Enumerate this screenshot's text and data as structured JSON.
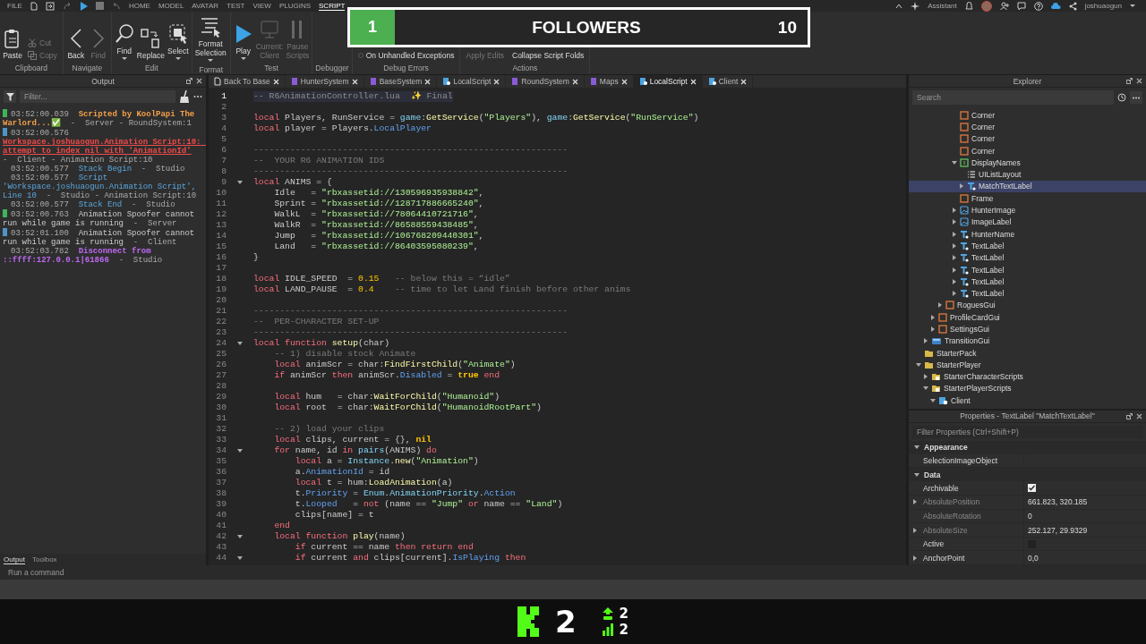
{
  "menu": {
    "file": "FILE",
    "tabs": [
      {
        "label": "HOME",
        "selected": false
      },
      {
        "label": "MODEL",
        "selected": false
      },
      {
        "label": "AVATAR",
        "selected": false
      },
      {
        "label": "TEST",
        "selected": false
      },
      {
        "label": "VIEW",
        "selected": false
      },
      {
        "label": "PLUGINS",
        "selected": false
      },
      {
        "label": "SCRIPT",
        "selected": true
      }
    ],
    "assistant": "Assistant",
    "user": "joshuaogun"
  },
  "ribbon": {
    "groups": [
      {
        "label": "Clipboard",
        "columns": [
          [
            {
              "kind": "large",
              "label": "Paste",
              "disabled": false,
              "caret": false
            }
          ],
          [
            {
              "kind": "small",
              "label": "Cut",
              "disabled": true
            },
            {
              "kind": "small",
              "label": "Copy",
              "disabled": true
            }
          ]
        ]
      },
      {
        "label": "Navigate",
        "columns": [
          [
            {
              "kind": "large",
              "label": "Back",
              "disabled": false,
              "caret": false
            }
          ],
          [
            {
              "kind": "large",
              "label": "Find",
              "disabled": true,
              "caret": false
            }
          ]
        ]
      },
      {
        "label": "Edit",
        "columns": [
          [
            {
              "kind": "large",
              "label": "Find",
              "disabled": false,
              "caret": true
            }
          ],
          [
            {
              "kind": "large",
              "label": "Replace",
              "disabled": false,
              "caret": false
            }
          ],
          [
            {
              "kind": "large",
              "label": "Select",
              "disabled": false,
              "caret": true
            }
          ]
        ]
      },
      {
        "label": "Format",
        "columns": [
          [
            {
              "kind": "large",
              "label": "Format Selection",
              "disabled": false,
              "caret": true
            }
          ]
        ]
      },
      {
        "label": "Test",
        "columns": [
          [
            {
              "kind": "large",
              "label": "Play",
              "disabled": false,
              "caret": true
            }
          ],
          [
            {
              "kind": "large",
              "label": "Current: Client",
              "disabled": true,
              "caret": false
            }
          ],
          [
            {
              "kind": "large",
              "label": "Pause Scripts",
              "disabled": true,
              "caret": false
            }
          ]
        ]
      },
      {
        "label": "Debugger"
      },
      {
        "label": "Debug Errors",
        "columns": [
          [
            {
              "kind": "radio",
              "label": "On Unhandled Exceptions",
              "selected": false
            }
          ]
        ]
      },
      {
        "label": "Actions",
        "columns": [
          [
            {
              "kind": "small",
              "label": "Apply Edits",
              "disabled": true
            }
          ],
          [
            {
              "kind": "small",
              "label": "Collapse Script Folds",
              "disabled": false
            }
          ]
        ]
      }
    ]
  },
  "overlay": {
    "rank": "1",
    "label": "FOLLOWERS",
    "count": "10"
  },
  "output": {
    "title": "Output",
    "filter_placeholder": "Filter...",
    "entries": [
      {
        "color": "#3cb45a",
        "time": "03:52:00.039",
        "message": "Scripted by KoolPapi The Warlord...✅",
        "kind": "print",
        "source": "-  Server - RoundSystem:1"
      },
      {
        "color": "#4f94c8",
        "time": "03:52:00.576",
        "message": "Workspace.joshuaogun.Animation Script:10: attempt to index nil with 'AnimationId'",
        "kind": "error",
        "source": "-  Client - Animation Script:10"
      },
      {
        "time": "03:52:00.577",
        "message": "Stack Begin",
        "kind": "info",
        "source": "-  Studio"
      },
      {
        "time": "03:52:00.577",
        "message": "Script 'Workspace.joshuaogun.Animation Script', Line 10",
        "kind": "info",
        "source": "-  Studio - Animation Script:10"
      },
      {
        "time": "03:52:00.577",
        "message": "Stack End",
        "kind": "info",
        "source": "-  Studio"
      },
      {
        "color": "#3cb45a",
        "time": "03:52:00.763",
        "message": "Animation Spoofer cannot run while game is running",
        "kind": "plain",
        "source": "-  Server"
      },
      {
        "color": "#4f94c8",
        "time": "03:52:01.100",
        "message": "Animation Spoofer cannot run while game is running",
        "kind": "plain",
        "source": "-  Client"
      },
      {
        "time": "03:52:03.782",
        "message": "Disconnect from ::ffff:127.0.0.1|61866",
        "kind": "network",
        "source": "-  Studio"
      }
    ],
    "tabs": [
      {
        "label": "Output",
        "selected": true
      },
      {
        "label": "Toolbox",
        "selected": false
      }
    ]
  },
  "editor": {
    "tabs": [
      {
        "label": "Back To Base",
        "kind": "doc",
        "selected": false
      },
      {
        "label": "HunterSystem",
        "kind": "module",
        "selected": false
      },
      {
        "label": "BaseSystem",
        "kind": "module",
        "selected": false
      },
      {
        "label": "LocalScript",
        "kind": "local",
        "selected": false
      },
      {
        "label": "RoundSystem",
        "kind": "module",
        "selected": false
      },
      {
        "label": "Maps",
        "kind": "module",
        "selected": false
      },
      {
        "label": "LocalScript",
        "kind": "local",
        "selected": true
      },
      {
        "label": "Client",
        "kind": "local",
        "selected": false
      }
    ],
    "lines": [
      {
        "n": "1",
        "current": true,
        "fold": false,
        "tokens": [
          {
            "kind": "comment",
            "text": "-- R6AnimationController.lua  ✨ Final"
          }
        ]
      },
      {
        "n": "2",
        "current": false,
        "fold": false
      },
      {
        "n": "3",
        "current": false,
        "fold": false,
        "tokens": [
          {
            "kind": "keyword",
            "text": "local"
          },
          {
            "kind": "plain",
            "text": " Players, RunService = "
          },
          {
            "kind": "builtin",
            "text": "game"
          },
          {
            "kind": "plain",
            "text": ":"
          },
          {
            "kind": "method",
            "text": "GetService"
          },
          {
            "kind": "plain",
            "text": "("
          },
          {
            "kind": "string",
            "text": "\"Players\""
          },
          {
            "kind": "plain",
            "text": "), "
          },
          {
            "kind": "builtin",
            "text": "game"
          },
          {
            "kind": "plain",
            "text": ":"
          },
          {
            "kind": "method",
            "text": "GetService"
          },
          {
            "kind": "plain",
            "text": "("
          },
          {
            "kind": "string",
            "text": "\"RunService\""
          },
          {
            "kind": "plain",
            "text": ")"
          }
        ]
      },
      {
        "n": "4",
        "current": false,
        "fold": false,
        "tokens": [
          {
            "kind": "keyword",
            "text": "local"
          },
          {
            "kind": "plain",
            "text": " player = Players."
          },
          {
            "kind": "property",
            "text": "LocalPlayer"
          }
        ]
      },
      {
        "n": "5",
        "current": false,
        "fold": false
      },
      {
        "n": "6",
        "current": false,
        "fold": false,
        "tokens": [
          {
            "kind": "comment",
            "text": "------------------------------------------------------------"
          }
        ]
      },
      {
        "n": "7",
        "current": false,
        "fold": false,
        "tokens": [
          {
            "kind": "comment",
            "text": "--  YOUR R6 ANIMATION IDS"
          }
        ]
      },
      {
        "n": "8",
        "current": false,
        "fold": false,
        "tokens": [
          {
            "kind": "comment",
            "text": "------------------------------------------------------------"
          }
        ]
      },
      {
        "n": "9",
        "current": false,
        "fold": true,
        "tokens": [
          {
            "kind": "keyword",
            "text": "local"
          },
          {
            "kind": "plain",
            "text": " ANIMS = {"
          }
        ]
      },
      {
        "n": "10",
        "current": false,
        "fold": false,
        "tokens": [
          {
            "kind": "plain",
            "text": "    Idle   = "
          },
          {
            "kind": "string",
            "text": "\"rbxassetid://130596935938842\""
          },
          {
            "kind": "plain",
            "text": ","
          }
        ]
      },
      {
        "n": "11",
        "current": false,
        "fold": false,
        "tokens": [
          {
            "kind": "plain",
            "text": "    Sprint = "
          },
          {
            "kind": "string",
            "text": "\"rbxassetid://128717886665240\""
          },
          {
            "kind": "plain",
            "text": ","
          }
        ]
      },
      {
        "n": "12",
        "current": false,
        "fold": false,
        "tokens": [
          {
            "kind": "plain",
            "text": "    WalkL  = "
          },
          {
            "kind": "string",
            "text": "\"rbxassetid://78064410721716\""
          },
          {
            "kind": "plain",
            "text": ","
          }
        ]
      },
      {
        "n": "13",
        "current": false,
        "fold": false,
        "tokens": [
          {
            "kind": "plain",
            "text": "    WalkR  = "
          },
          {
            "kind": "string",
            "text": "\"rbxassetid://86588559438485\""
          },
          {
            "kind": "plain",
            "text": ","
          }
        ]
      },
      {
        "n": "14",
        "current": false,
        "fold": false,
        "tokens": [
          {
            "kind": "plain",
            "text": "    Jump   = "
          },
          {
            "kind": "string",
            "text": "\"rbxassetid://106768209440301\""
          },
          {
            "kind": "plain",
            "text": ","
          }
        ]
      },
      {
        "n": "15",
        "current": false,
        "fold": false,
        "tokens": [
          {
            "kind": "plain",
            "text": "    Land   = "
          },
          {
            "kind": "string",
            "text": "\"rbxassetid://86403595080239\""
          },
          {
            "kind": "plain",
            "text": ","
          }
        ]
      },
      {
        "n": "16",
        "current": false,
        "fold": false,
        "tokens": [
          {
            "kind": "plain",
            "text": "}"
          }
        ]
      },
      {
        "n": "17",
        "current": false,
        "fold": false
      },
      {
        "n": "18",
        "current": false,
        "fold": false,
        "tokens": [
          {
            "kind": "keyword",
            "text": "local"
          },
          {
            "kind": "plain",
            "text": " IDLE_SPEED  = "
          },
          {
            "kind": "number",
            "text": "0.15"
          },
          {
            "kind": "comment",
            "text": "   -- below this = “idle”"
          }
        ]
      },
      {
        "n": "19",
        "current": false,
        "fold": false,
        "tokens": [
          {
            "kind": "keyword",
            "text": "local"
          },
          {
            "kind": "plain",
            "text": " LAND_PAUSE  = "
          },
          {
            "kind": "number",
            "text": "0.4"
          },
          {
            "kind": "comment",
            "text": "    -- time to let Land finish before other anims"
          }
        ]
      },
      {
        "n": "20",
        "current": false,
        "fold": false
      },
      {
        "n": "21",
        "current": false,
        "fold": false,
        "tokens": [
          {
            "kind": "comment",
            "text": "------------------------------------------------------------"
          }
        ]
      },
      {
        "n": "22",
        "current": false,
        "fold": false,
        "tokens": [
          {
            "kind": "comment",
            "text": "--  PER-CHARACTER SET-UP"
          }
        ]
      },
      {
        "n": "23",
        "current": false,
        "fold": false,
        "tokens": [
          {
            "kind": "comment",
            "text": "------------------------------------------------------------"
          }
        ]
      },
      {
        "n": "24",
        "current": false,
        "fold": true,
        "tokens": [
          {
            "kind": "keyword",
            "text": "local function"
          },
          {
            "kind": "method",
            "text": " setup"
          },
          {
            "kind": "plain",
            "text": "(char)"
          }
        ]
      },
      {
        "n": "25",
        "current": false,
        "fold": false,
        "tokens": [
          {
            "kind": "comment",
            "text": "    -- 1) disable stock Animate"
          }
        ]
      },
      {
        "n": "26",
        "current": false,
        "fold": false,
        "tokens": [
          {
            "kind": "keyword",
            "text": "    local"
          },
          {
            "kind": "plain",
            "text": " animScr = char:"
          },
          {
            "kind": "method",
            "text": "FindFirstChild"
          },
          {
            "kind": "plain",
            "text": "("
          },
          {
            "kind": "string",
            "text": "\"Animate\""
          },
          {
            "kind": "plain",
            "text": ")"
          }
        ]
      },
      {
        "n": "27",
        "current": false,
        "fold": false,
        "tokens": [
          {
            "kind": "keyword",
            "text": "    if"
          },
          {
            "kind": "plain",
            "text": " animScr "
          },
          {
            "kind": "keyword",
            "text": "then"
          },
          {
            "kind": "plain",
            "text": " animScr."
          },
          {
            "kind": "property",
            "text": "Disabled"
          },
          {
            "kind": "plain",
            "text": " = "
          },
          {
            "kind": "literal",
            "text": "true"
          },
          {
            "kind": "keyword",
            "text": " end"
          }
        ]
      },
      {
        "n": "28",
        "current": false,
        "fold": false
      },
      {
        "n": "29",
        "current": false,
        "fold": false,
        "tokens": [
          {
            "kind": "keyword",
            "text": "    local"
          },
          {
            "kind": "plain",
            "text": " hum   = char:"
          },
          {
            "kind": "method",
            "text": "WaitForChild"
          },
          {
            "kind": "plain",
            "text": "("
          },
          {
            "kind": "string",
            "text": "\"Humanoid\""
          },
          {
            "kind": "plain",
            "text": ")"
          }
        ]
      },
      {
        "n": "30",
        "current": false,
        "fold": false,
        "tokens": [
          {
            "kind": "keyword",
            "text": "    local"
          },
          {
            "kind": "plain",
            "text": " root  = char:"
          },
          {
            "kind": "method",
            "text": "WaitForChild"
          },
          {
            "kind": "plain",
            "text": "("
          },
          {
            "kind": "string",
            "text": "\"HumanoidRootPart\""
          },
          {
            "kind": "plain",
            "text": ")"
          }
        ]
      },
      {
        "n": "31",
        "current": false,
        "fold": false
      },
      {
        "n": "32",
        "current": false,
        "fold": false,
        "tokens": [
          {
            "kind": "comment",
            "text": "    -- 2) load your clips"
          }
        ]
      },
      {
        "n": "33",
        "current": false,
        "fold": false,
        "tokens": [
          {
            "kind": "keyword",
            "text": "    local"
          },
          {
            "kind": "plain",
            "text": " clips, current = {}, "
          },
          {
            "kind": "literal",
            "text": "nil"
          }
        ]
      },
      {
        "n": "34",
        "current": false,
        "fold": true,
        "tokens": [
          {
            "kind": "keyword",
            "text": "    for"
          },
          {
            "kind": "plain",
            "text": " name, id "
          },
          {
            "kind": "keyword",
            "text": "in"
          },
          {
            "kind": "builtin",
            "text": " pairs"
          },
          {
            "kind": "plain",
            "text": "(ANIMS) "
          },
          {
            "kind": "keyword",
            "text": "do"
          }
        ]
      },
      {
        "n": "35",
        "current": false,
        "fold": false,
        "tokens": [
          {
            "kind": "keyword",
            "text": "        local"
          },
          {
            "kind": "plain",
            "text": " a = "
          },
          {
            "kind": "builtin",
            "text": "Instance"
          },
          {
            "kind": "plain",
            "text": "."
          },
          {
            "kind": "method",
            "text": "new"
          },
          {
            "kind": "plain",
            "text": "("
          },
          {
            "kind": "string",
            "text": "\"Animation\""
          },
          {
            "kind": "plain",
            "text": ")"
          }
        ]
      },
      {
        "n": "36",
        "current": false,
        "fold": false,
        "tokens": [
          {
            "kind": "plain",
            "text": "        a."
          },
          {
            "kind": "property",
            "text": "AnimationId"
          },
          {
            "kind": "plain",
            "text": " = id"
          }
        ]
      },
      {
        "n": "37",
        "current": false,
        "fold": false,
        "tokens": [
          {
            "kind": "keyword",
            "text": "        local"
          },
          {
            "kind": "plain",
            "text": " t = hum:"
          },
          {
            "kind": "method",
            "text": "LoadAnimation"
          },
          {
            "kind": "plain",
            "text": "(a)"
          }
        ]
      },
      {
        "n": "38",
        "current": false,
        "fold": false,
        "tokens": [
          {
            "kind": "plain",
            "text": "        t."
          },
          {
            "kind": "property",
            "text": "Priority"
          },
          {
            "kind": "plain",
            "text": " = "
          },
          {
            "kind": "builtin",
            "text": "Enum"
          },
          {
            "kind": "plain",
            "text": "."
          },
          {
            "kind": "builtin",
            "text": "AnimationPriority"
          },
          {
            "kind": "plain",
            "text": "."
          },
          {
            "kind": "property",
            "text": "Action"
          }
        ]
      },
      {
        "n": "39",
        "current": false,
        "fold": false,
        "tokens": [
          {
            "kind": "plain",
            "text": "        t."
          },
          {
            "kind": "property",
            "text": "Looped"
          },
          {
            "kind": "plain",
            "text": "   = "
          },
          {
            "kind": "keyword",
            "text": "not"
          },
          {
            "kind": "plain",
            "text": " (name == "
          },
          {
            "kind": "string",
            "text": "\"Jump\""
          },
          {
            "kind": "keyword",
            "text": " or"
          },
          {
            "kind": "plain",
            "text": " name == "
          },
          {
            "kind": "string",
            "text": "\"Land\""
          },
          {
            "kind": "plain",
            "text": ")"
          }
        ]
      },
      {
        "n": "40",
        "current": false,
        "fold": false,
        "tokens": [
          {
            "kind": "plain",
            "text": "        clips[name] = t"
          }
        ]
      },
      {
        "n": "41",
        "current": false,
        "fold": false,
        "tokens": [
          {
            "kind": "keyword",
            "text": "    end"
          }
        ]
      },
      {
        "n": "42",
        "current": false,
        "fold": true,
        "tokens": [
          {
            "kind": "keyword",
            "text": "    local function"
          },
          {
            "kind": "method",
            "text": " play"
          },
          {
            "kind": "plain",
            "text": "(name)"
          }
        ]
      },
      {
        "n": "43",
        "current": false,
        "fold": false,
        "tokens": [
          {
            "kind": "keyword",
            "text": "        if"
          },
          {
            "kind": "plain",
            "text": " current == name "
          },
          {
            "kind": "keyword",
            "text": "then return end"
          }
        ]
      },
      {
        "n": "44",
        "current": false,
        "fold": true,
        "tokens": [
          {
            "kind": "keyword",
            "text": "        if"
          },
          {
            "kind": "plain",
            "text": " current "
          },
          {
            "kind": "keyword",
            "text": "and"
          },
          {
            "kind": "plain",
            "text": " clips[current]."
          },
          {
            "kind": "property",
            "text": "IsPlaying"
          },
          {
            "kind": "keyword",
            "text": " then"
          }
        ]
      }
    ]
  },
  "explorer": {
    "title": "Explorer",
    "search_placeholder": "Search",
    "tree": [
      {
        "children": [
          {
            "children": [
              {
                "children": [
                  {
                    "children": [
                      {
                        "children": [
                          {
                            "label": "Corner",
                            "kind": "corner",
                            "selected": false
                          },
                          {
                            "label": "Corner",
                            "kind": "corner",
                            "selected": false
                          },
                          {
                            "label": "Corner",
                            "kind": "corner",
                            "selected": false
                          },
                          {
                            "label": "Corner",
                            "kind": "corner",
                            "selected": false
                          },
                          {
                            "label": "DisplayNames",
                            "kind": "frame",
                            "selected": false,
                            "expanded": true,
                            "children": [
                              {
                                "label": "UIListLayout",
                                "kind": "list",
                                "selected": false
                              },
                              {
                                "label": "MatchTextLabel",
                                "kind": "text",
                                "selected": true,
                                "expanded": false
                              }
                            ]
                          },
                          {
                            "label": "Frame",
                            "kind": "corner",
                            "selected": false
                          },
                          {
                            "label": "HunterImage",
                            "kind": "image",
                            "selected": false,
                            "expanded": false
                          },
                          {
                            "label": "ImageLabel",
                            "kind": "image",
                            "selected": false,
                            "expanded": false
                          },
                          {
                            "label": "HunterName",
                            "kind": "text",
                            "selected": false,
                            "expanded": false
                          },
                          {
                            "label": "TextLabel",
                            "kind": "text",
                            "selected": false,
                            "expanded": false
                          },
                          {
                            "label": "TextLabel",
                            "kind": "text",
                            "selected": false,
                            "expanded": false
                          },
                          {
                            "label": "TextLabel",
                            "kind": "text",
                            "selected": false,
                            "expanded": false
                          },
                          {
                            "label": "TextLabel",
                            "kind": "text",
                            "selected": false,
                            "expanded": false
                          },
                          {
                            "label": "TextLabel",
                            "kind": "text",
                            "selected": false,
                            "expanded": false
                          }
                        ]
                      }
                    ]
                  },
                  {
                    "label": "RoguesGui",
                    "kind": "corner",
                    "selected": false,
                    "expanded": false
                  }
                ]
              },
              {
                "label": "ProfileCardGui",
                "kind": "corner",
                "selected": false,
                "expanded": false
              },
              {
                "label": "SettingsGui",
                "kind": "corner",
                "selected": false,
                "expanded": false
              }
            ]
          },
          {
            "label": "TransitionGui",
            "kind": "screen",
            "selected": false,
            "expanded": false
          }
        ]
      },
      {
        "label": "StarterPack",
        "kind": "pack",
        "selected": false
      },
      {
        "label": "StarterPlayer",
        "kind": "pack",
        "selected": false,
        "expanded": true,
        "children": [
          {
            "label": "StarterCharacterScripts",
            "kind": "scripts",
            "selected": false,
            "expanded": false
          },
          {
            "label": "StarterPlayerScripts",
            "kind": "scripts",
            "selected": false,
            "expanded": true,
            "children": [
              {
                "label": "Client",
                "kind": "local",
                "selected": false,
                "expanded": true
              }
            ]
          }
        ]
      }
    ]
  },
  "properties": {
    "title": "Properties - TextLabel \"MatchTextLabel\"",
    "filter_placeholder": "Filter Properties (Ctrl+Shift+P)",
    "sections": [
      {
        "name": "Appearance",
        "expanded": true,
        "rows": [
          {
            "name": "SelectionImageObject",
            "kind": "text",
            "disabled": false
          }
        ]
      },
      {
        "name": "Data",
        "expanded": true,
        "rows": [
          {
            "name": "Archivable",
            "kind": "checkbox",
            "checked": true,
            "disabled": false
          },
          {
            "name": "AbsolutePosition",
            "kind": "text",
            "value": "661.823, 320.185",
            "disabled": true,
            "expanded": false
          },
          {
            "name": "AbsoluteRotation",
            "kind": "text",
            "value": "0",
            "disabled": true
          },
          {
            "name": "AbsoluteSize",
            "kind": "text",
            "value": "252.127, 29.9329",
            "disabled": true,
            "expanded": false
          },
          {
            "name": "Active",
            "kind": "checkbox",
            "checked": false,
            "disabled": false
          },
          {
            "name": "AnchorPoint",
            "kind": "text",
            "value": "0,0",
            "disabled": false,
            "expanded": false
          }
        ]
      }
    ]
  },
  "command_bar": {
    "placeholder": "Run a command"
  },
  "stream_bar": {
    "count": "2",
    "stats": [
      {
        "kind": "up",
        "value": "2"
      },
      {
        "kind": "bars",
        "value": "2"
      }
    ]
  }
}
